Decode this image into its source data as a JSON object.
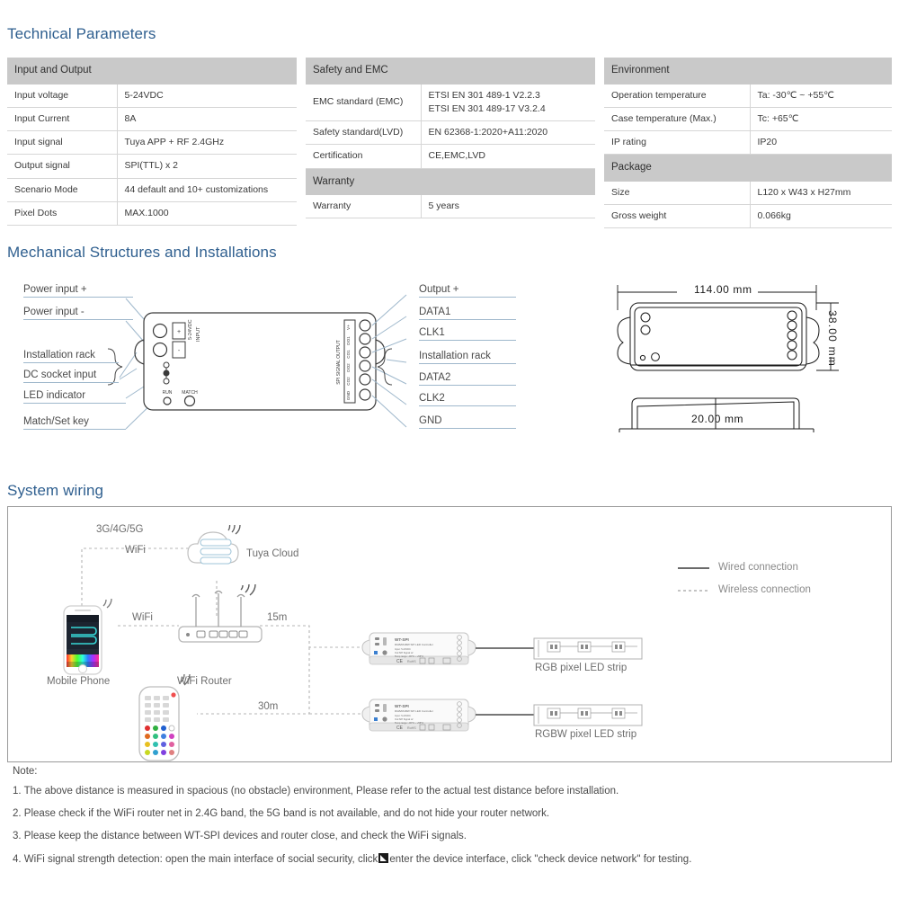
{
  "sections": {
    "technical_parameters": "Technical Parameters",
    "mechanical": "Mechanical Structures and Installations",
    "system_wiring": "System wiring"
  },
  "colors": {
    "heading": "#2f5f8f",
    "table_header_bg": "#c9c9c9",
    "rule": "#d6d6d6",
    "leader": "#9fb8cc"
  },
  "tables": {
    "input_output": {
      "header": "Input and Output",
      "rows": [
        {
          "label": "Input voltage",
          "value": "5-24VDC"
        },
        {
          "label": "Input Current",
          "value": "8A"
        },
        {
          "label": "Input  signal",
          "value": "Tuya APP + RF 2.4GHz"
        },
        {
          "label": "Output signal",
          "value": "SPI(TTL) x 2"
        },
        {
          "label": "Scenario Mode",
          "value": "44 default and 10+ customizations"
        },
        {
          "label": "Pixel Dots",
          "value": "MAX.1000"
        }
      ]
    },
    "safety_emc": {
      "header": "Safety and EMC",
      "rows": [
        {
          "label": "EMC standard (EMC)",
          "value": "ETSI EN 301 489-1 V2.2.3",
          "value2": "ETSI EN 301 489-17 V3.2.4"
        },
        {
          "label": "Safety standard(LVD)",
          "value": "EN 62368-1:2020+A11:2020"
        },
        {
          "label": "Certification",
          "value": "CE,EMC,LVD"
        }
      ],
      "header2": "Warranty",
      "rows2": [
        {
          "label": "Warranty",
          "value": "5 years"
        }
      ]
    },
    "environment": {
      "header": "Environment",
      "rows": [
        {
          "label": "Operation temperature",
          "value": "Ta: -30℃ ~ +55℃"
        },
        {
          "label": "Case temperature (Max.)",
          "value": "Tc: +65℃"
        },
        {
          "label": "IP rating",
          "value": "IP20"
        }
      ],
      "header2": "Package",
      "rows2": [
        {
          "label": "Size",
          "value": "L120 x W43 x H27mm"
        },
        {
          "label": "Gross weight",
          "value": "0.066kg"
        }
      ]
    }
  },
  "mechanical": {
    "left_labels": [
      "Power input +",
      "Power input -",
      "Installation rack",
      "DC socket input",
      "LED indicator",
      "Match/Set key"
    ],
    "right_labels": [
      "Output +",
      "DATA1",
      "CLK1",
      "Installation rack",
      "DATA2",
      "CLK2",
      "GND"
    ],
    "device_silk": {
      "input_block": "INPUT",
      "input_voltage": "5-24VDC",
      "plus": "+",
      "minus": "-",
      "run": "RUN",
      "match": "MATCH",
      "output_block": "SPI SIGNAL OUTPUT",
      "terminals": [
        "V+",
        "DO1",
        "CO1",
        "DO2",
        "CO2",
        "GND"
      ]
    },
    "dimensions": {
      "length": "114.00 mm",
      "width": "38.00 mm",
      "height": "20.00 mm"
    }
  },
  "wiring": {
    "labels": {
      "mobile_phone": "Mobile Phone",
      "wifi_router": "WiFi Router",
      "tuya_cloud": "Tuya Cloud",
      "cellular": "3G/4G/5G",
      "wifi_cloud": "WiFi",
      "wifi_router_link": "WiFi",
      "distance_router": "15m",
      "distance_remote": "30m",
      "rgb_strip": "RGB pixel LED strip",
      "rgbw_strip": "RGBW pixel LED strip",
      "controller_model": "WT-SPI"
    },
    "legend": {
      "wired": "Wired connection",
      "wireless": "Wireless connection"
    }
  },
  "notes": {
    "title": "Note:",
    "items": [
      "1. The above distance is measured in spacious (no obstacle) environment, Please refer to the actual test distance before installation.",
      "2. Please check if the WiFi router net in 2.4G band, the 5G band is not available, and do not hide your router network.",
      "3. Please keep the distance between WT-SPI devices and router close, and check the WiFi signals."
    ],
    "item4_a": "4. WiFi signal strength detection: open the main interface of social security, click",
    "item4_b": "enter the device interface, click \"check device network\" for testing."
  }
}
